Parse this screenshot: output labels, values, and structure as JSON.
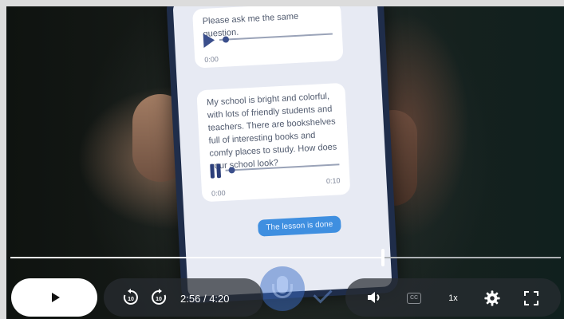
{
  "lesson": {
    "bubble1_text": "Please ask me the same question.",
    "bubble1_time": "0:00",
    "bubble2_text": "My school is bright and colorful, with lots of friendly students and teachers. There are bookshelves full of interesting books and comfy places to study. How does your school look?",
    "bubble2_time_start": "0:00",
    "bubble2_time_end": "0:10",
    "done_button": "The lesson is done"
  },
  "player": {
    "current_time": "2:56",
    "separator": "/",
    "duration": "4:20",
    "progress_fraction": 0.677,
    "speed_label": "1x",
    "captions_label": "CC",
    "seek_back_label": "10",
    "seek_forward_label": "10"
  },
  "icons": {
    "play": "play-icon",
    "seek_back": "rewind-10-icon",
    "seek_forward": "forward-10-icon",
    "volume": "volume-icon",
    "captions": "cc-icon",
    "settings": "gear-icon",
    "fullscreen": "fullscreen-icon"
  },
  "colors": {
    "progress_played": "#ffffff",
    "progress_remaining": "#aeb2b5",
    "accent_blue": "#3f8fe0"
  }
}
